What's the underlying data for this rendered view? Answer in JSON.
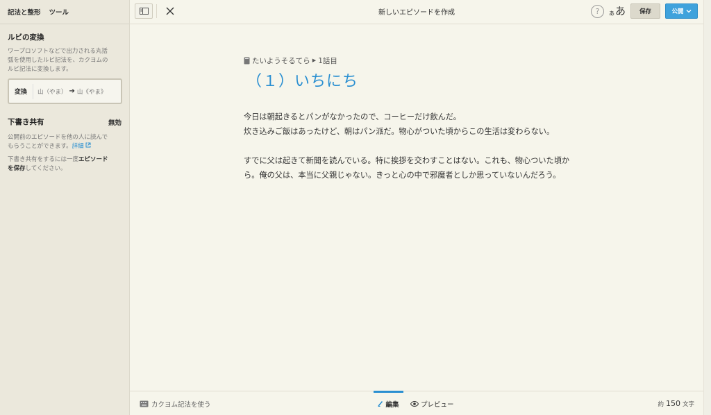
{
  "sidebar": {
    "tabs": [
      "記法と整形",
      "ツール"
    ],
    "ruby": {
      "title": "ルビの変換",
      "desc_lines": [
        "ワープロソフトなどで出力される丸括",
        "弧を使用したルビ記法を、カクヨムの",
        "ルビ記法に変換します。"
      ],
      "button_label": "変換",
      "example_from": "山（やま）",
      "example_to": "山《やま》"
    },
    "draft_share": {
      "title": "下書き共有",
      "status": "無効",
      "desc_lines": [
        "公開前のエピソードを他の人に読んで",
        "もらうことができます。"
      ],
      "details_link": "詳細",
      "note_prefix": "下書き共有をするには一度",
      "note_bold1": "エピソード",
      "note_bold2": "を保存",
      "note_suffix": "してください。"
    }
  },
  "topbar": {
    "page_title": "新しいエピソードを作成",
    "help_label": "?",
    "font_small": "あ",
    "font_big": "あ",
    "save_label": "保存",
    "publish_label": "公開"
  },
  "editor": {
    "work_title": "たいようそるてら",
    "episode_no": "1話目",
    "episode_title": "（１）いちにち",
    "paragraphs": [
      [
        "今日は朝起きるとパンがなかったので、コーヒーだけ飲んだ。",
        "炊き込みご飯はあったけど、朝はパン派だ。物心がついた頃からこの生活は変わらない。"
      ],
      [
        "すでに父は起きて新聞を読んでいる。特に挨拶を交わすことはない。これも、物心ついた頃か",
        "ら。俺の父は、本当に父親じゃない。きっと心の中で邪魔者としか思っていないんだろう。"
      ]
    ]
  },
  "bottombar": {
    "kakuyomu_label": "カクヨム記法を使う",
    "edit_tab": "編集",
    "preview_tab": "プレビュー",
    "count_prefix": "約",
    "count_value": "150",
    "count_suffix": "文字"
  },
  "colors": {
    "accent": "#2a8fd1",
    "publish_bg": "#3fa2dc",
    "sidebar_bg": "#ebe8dc",
    "page_bg": "#f6f5eb"
  }
}
